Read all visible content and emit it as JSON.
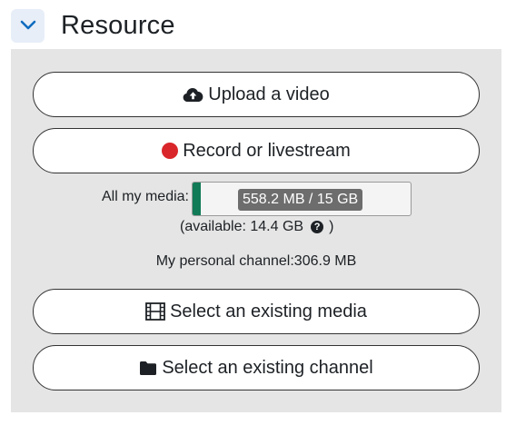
{
  "header": {
    "toggle_icon": "chevron-down-icon",
    "title": "Resource"
  },
  "buttons": {
    "upload": {
      "label": "Upload a video",
      "icon": "cloud-upload-icon"
    },
    "record": {
      "label": "Record or livestream",
      "icon": "record-dot-icon",
      "icon_color": "#d9262a"
    },
    "select_media": {
      "label": "Select an existing media",
      "icon": "film-icon"
    },
    "select_channel": {
      "label": "Select an existing channel",
      "icon": "folder-icon"
    }
  },
  "media": {
    "label": "All my media:",
    "progress_text": "558.2 MB / 15 GB",
    "used_fraction": 0.036,
    "fill_color": "#117a57",
    "available_prefix": "(available: 14.4 GB",
    "available_suffix": ")",
    "help_icon": "question-circle-icon",
    "help_glyph": "?"
  },
  "channel": {
    "label": "My personal channel:",
    "value": "306.9 MB"
  },
  "colors": {
    "panel_bg": "#e5e5e5",
    "toggle_bg": "#e7eef8",
    "accent": "#0f6cbf"
  }
}
